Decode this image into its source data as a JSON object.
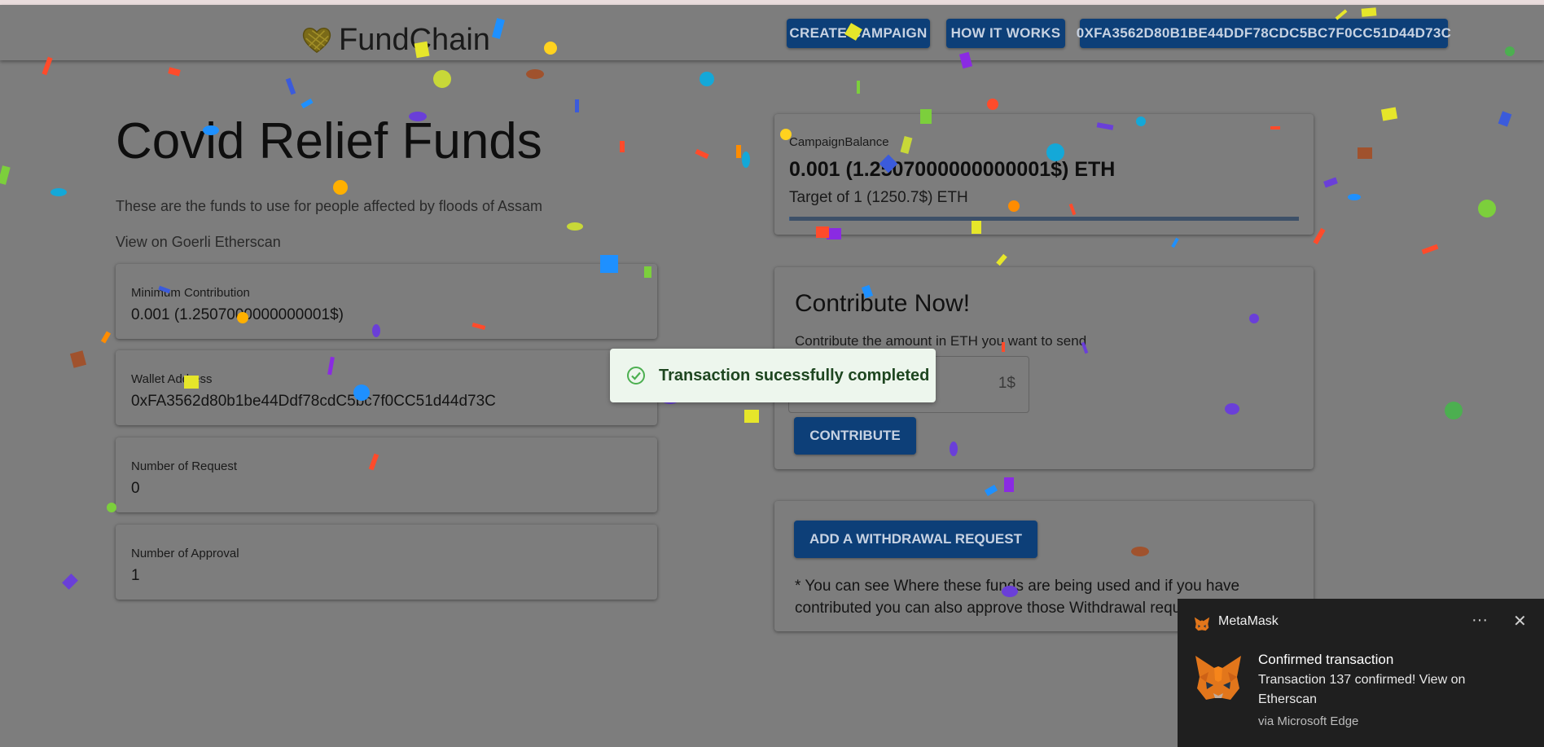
{
  "navbar": {
    "brand": "FundChain",
    "buttons": {
      "create": "CREATE CAMPAIGN",
      "how": "HOW IT WORKS",
      "account": "0XFA3562D80B1BE44DDF78CDC5BC7F0CC51D44D73C"
    }
  },
  "campaign": {
    "title": "Covid Relief Funds",
    "description": "These are the funds to use for people affected by floods of Assam",
    "etherscan_link": "View on Goerli Etherscan",
    "stats": [
      {
        "label": "Minimum Contribution",
        "value": "0.001 (1.2507000000000001$)"
      },
      {
        "label": "Wallet Address",
        "value": "0xFA3562d80b1be44Ddf78cdC5bc7f0CC51d44d73C"
      },
      {
        "label": "Number of Request",
        "value": "0"
      },
      {
        "label": "Number of Approval",
        "value": "1"
      }
    ]
  },
  "balance": {
    "label": "CampaignBalance",
    "value": "0.001 (1.2507000000000001$) ETH",
    "target": "Target of 1 (1250.7$) ETH",
    "progress_fraction": 0.001
  },
  "contribute": {
    "title": "Contribute Now!",
    "subtitle": "Contribute the amount in ETH you want to send",
    "unit": "1$",
    "button": "CONTRIBUTE"
  },
  "withdrawal": {
    "button": "ADD A WITHDRAWAL REQUEST",
    "note": "* You can see Where these funds are being used and if you have contributed you can also approve those Withdrawal requests"
  },
  "toast": {
    "message": "Transaction sucessfully completed",
    "color": "#4caf50"
  },
  "metamask": {
    "app": "MetaMask",
    "more": "···",
    "close": "✕",
    "title": "Confirmed transaction",
    "body": "Transaction 137 confirmed! View on Etherscan",
    "via": "via Microsoft Edge"
  },
  "colors": {
    "primary": "#0d3f78",
    "overlay": "#7d7d7d",
    "notification_bg": "#1f1f1f"
  }
}
